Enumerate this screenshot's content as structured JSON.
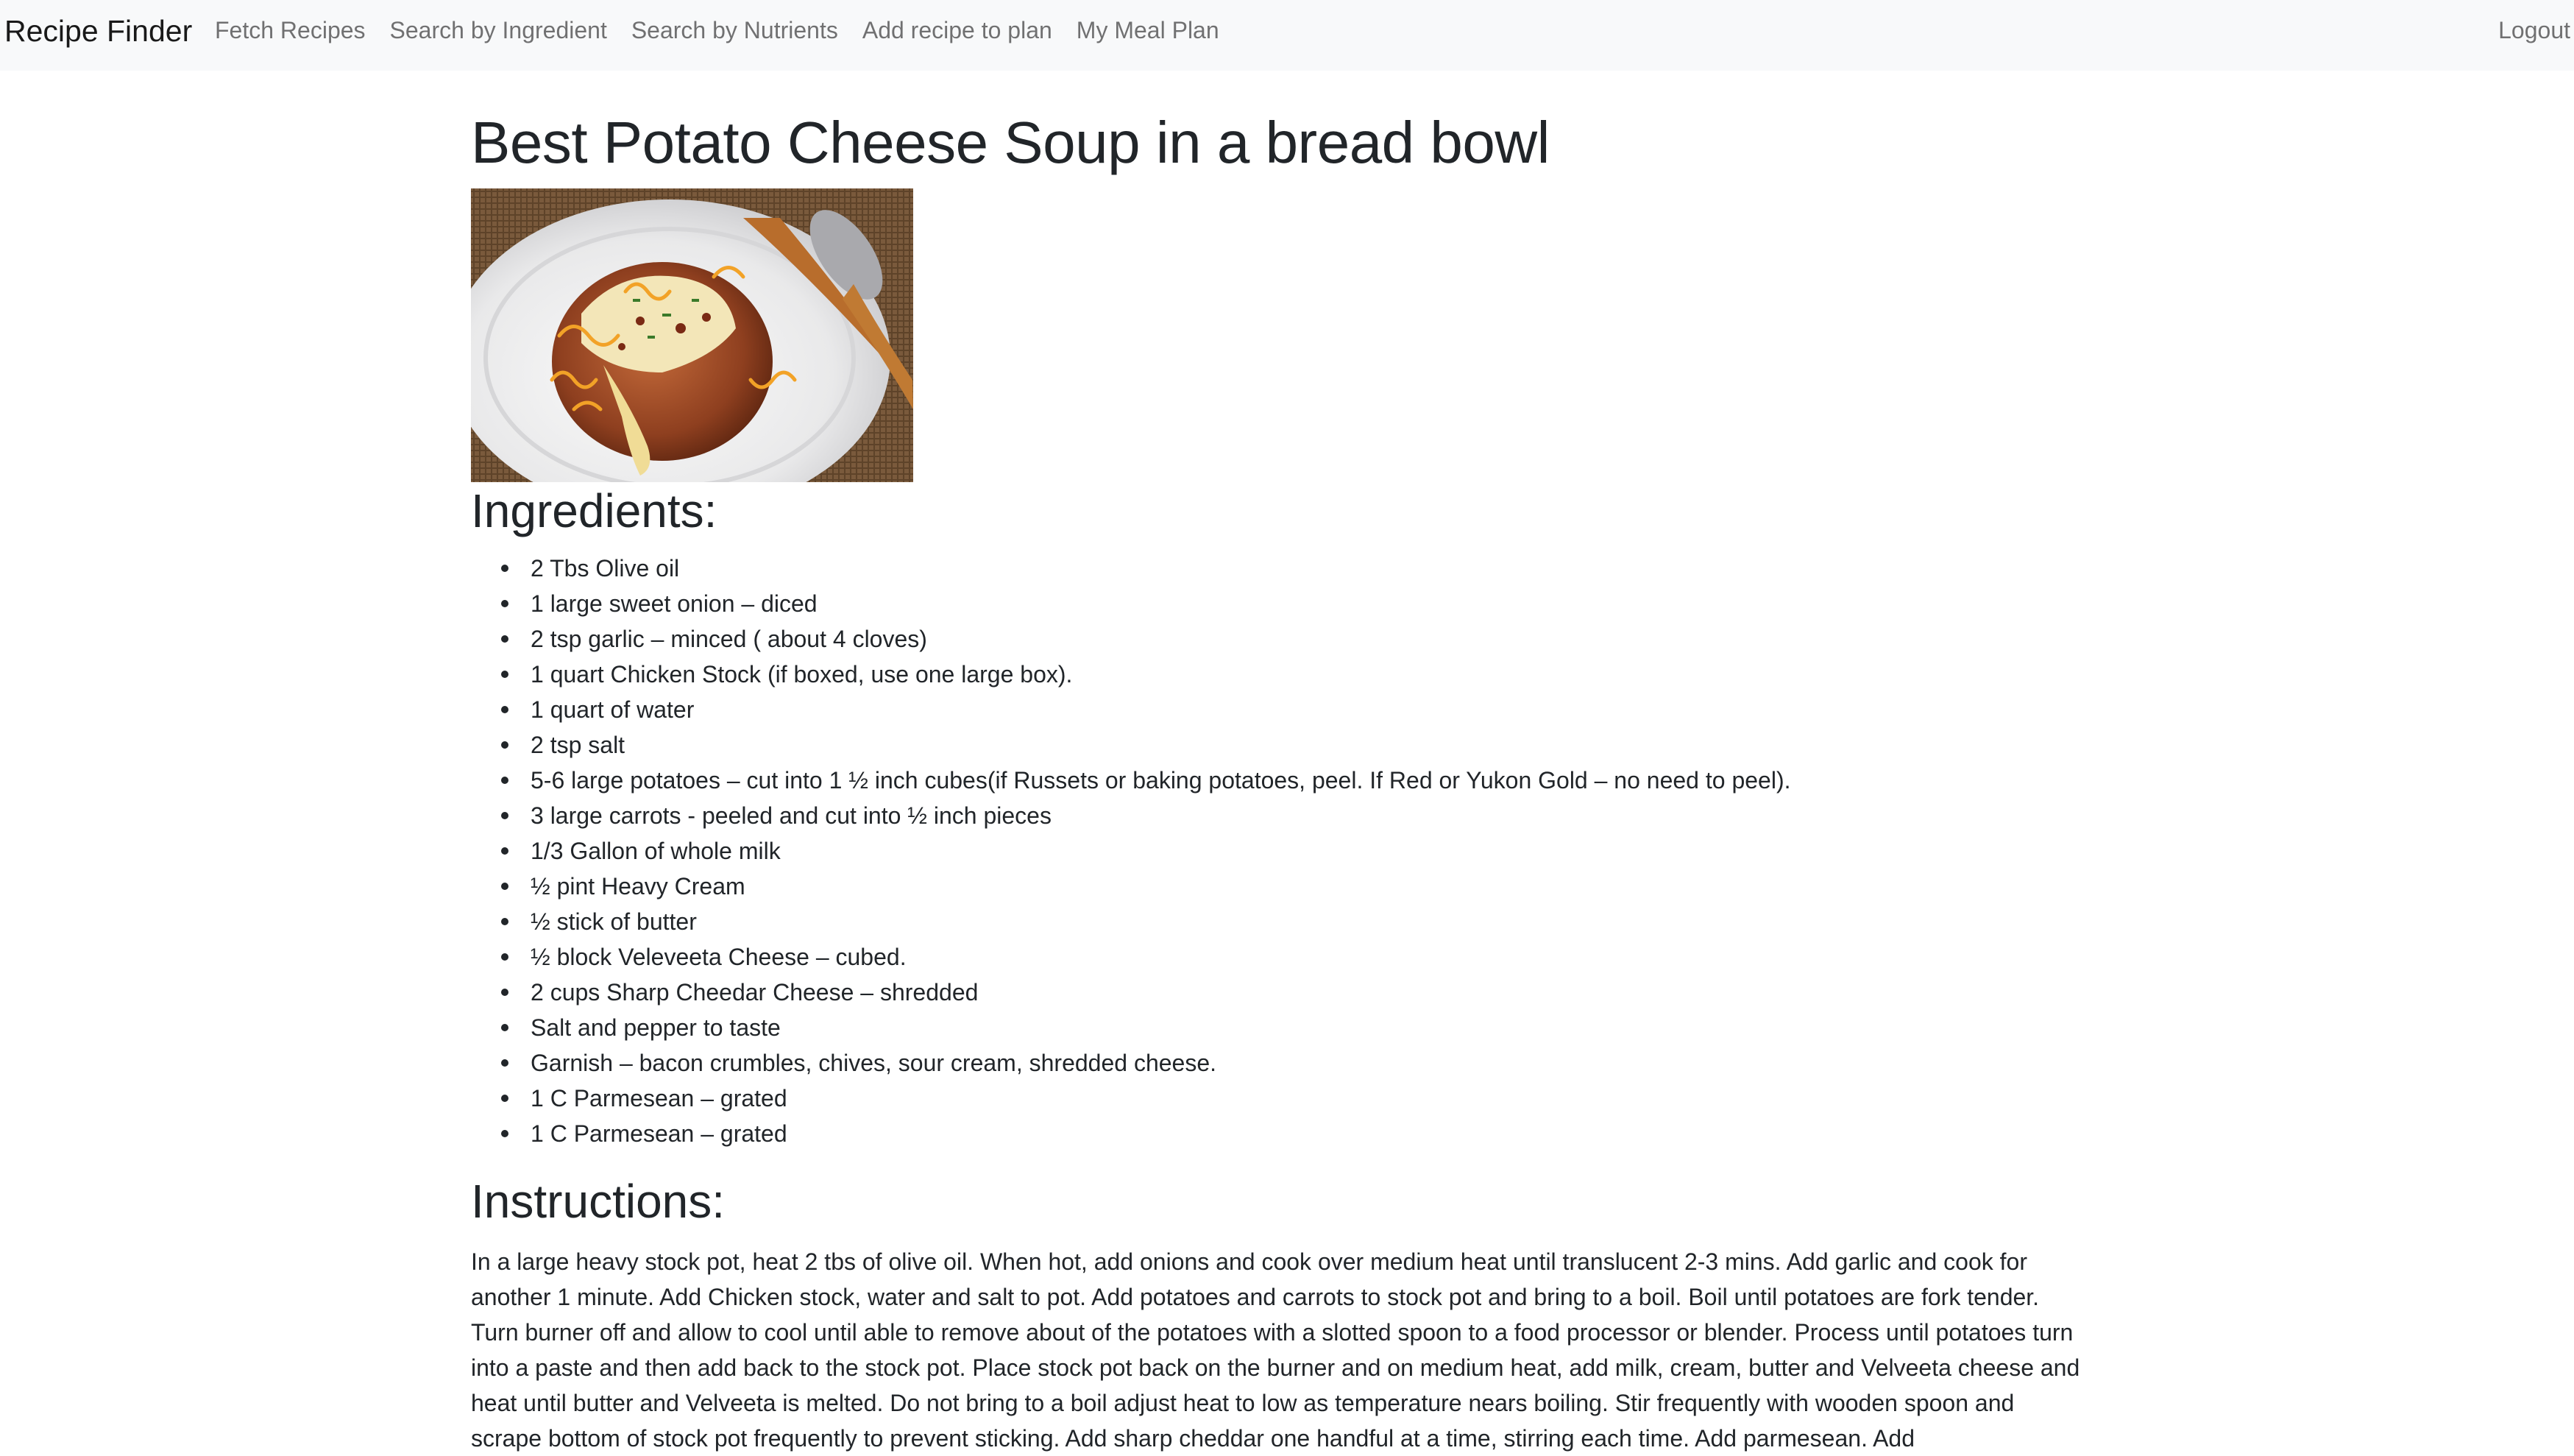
{
  "navbar": {
    "brand": "Recipe Finder",
    "links": [
      "Fetch Recipes",
      "Search by Ingredient",
      "Search by Nutrients",
      "Add recipe to plan",
      "My Meal Plan"
    ],
    "logout": "Logout"
  },
  "recipe": {
    "title": "Best Potato Cheese Soup in a bread bowl",
    "ingredients_heading": "Ingredients:",
    "ingredients": [
      "2 Tbs Olive oil",
      "1 large sweet onion – diced",
      "2 tsp garlic – minced ( about 4 cloves)",
      "1 quart Chicken Stock (if boxed, use one large box).",
      "1 quart of water",
      "2 tsp salt",
      "5-6 large potatoes – cut into 1 ½ inch cubes(if Russets or baking potatoes, peel. If Red or Yukon Gold – no need to peel).",
      "3 large carrots - peeled and cut into ½ inch pieces",
      "1/3 Gallon of whole milk",
      "½ pint Heavy Cream",
      "½ stick of butter",
      "½ block Veleveeta Cheese – cubed.",
      "2 cups Sharp Cheedar Cheese – shredded",
      "Salt and pepper to taste",
      "Garnish – bacon crumbles, chives, sour cream, shredded cheese.",
      "1 C Parmesean – grated",
      "1 C Parmesean – grated"
    ],
    "instructions_heading": "Instructions:",
    "instructions": "In a large heavy stock pot, heat 2 tbs of olive oil. When hot, add onions and cook over medium heat until translucent 2-3 mins. Add garlic and cook for another 1 minute. Add Chicken stock, water and salt to pot. Add potatoes and carrots to stock pot and bring to a boil. Boil until potatoes are fork tender. Turn burner off and allow to cool until able to remove about of the potatoes with a slotted spoon to a food processor or blender. Process until potatoes turn into a paste and then add back to the stock pot. Place stock pot back on the burner and on medium heat, add milk, cream, butter and Velveeta cheese and heat until butter and Velveeta is melted. Do not bring to a boil adjust heat to low as temperature nears boiling. Stir frequently with wooden spoon and scrape bottom of stock pot frequently to prevent sticking. Add sharp cheddar one handful at a time, stirring each time. Add parmesean. Add"
  }
}
